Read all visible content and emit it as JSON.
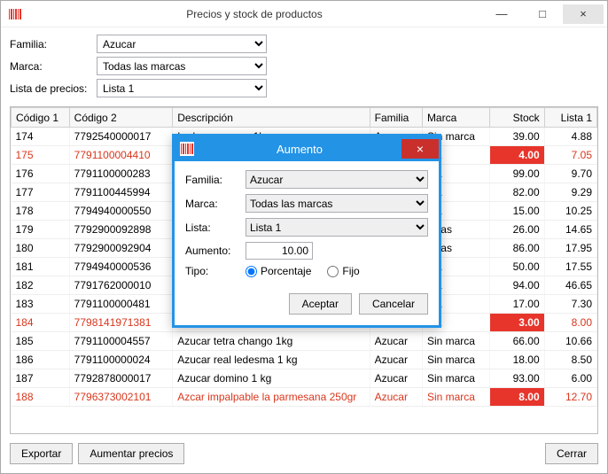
{
  "window": {
    "title": "Precios y stock de productos",
    "minimize": "—",
    "maximize": "□",
    "close": "×"
  },
  "filters": {
    "familia_label": "Familia:",
    "familia_value": "Azucar",
    "marca_label": "Marca:",
    "marca_value": "Todas las marcas",
    "lista_label": "Lista de precios:",
    "lista_value": "Lista 1"
  },
  "columns": {
    "codigo1": "Código 1",
    "codigo2": "Código 2",
    "descripcion": "Descripción",
    "familia": "Familia",
    "marca": "Marca",
    "stock": "Stock",
    "lista1": "Lista 1"
  },
  "rows": [
    {
      "c1": "174",
      "c2": "7792540000017",
      "desc": "Ledesma azcar 1kg",
      "fam": "Azucar",
      "marca": "Sin marca",
      "stock": "39.00",
      "price": "4.88",
      "red": false,
      "low": false
    },
    {
      "c1": "175",
      "c2": "7791100004410",
      "desc": "",
      "fam": "",
      "marca": "rca",
      "stock": "4.00",
      "price": "7.05",
      "red": true,
      "low": true
    },
    {
      "c1": "176",
      "c2": "7791100000283",
      "desc": "",
      "fam": "",
      "marca": "rca",
      "stock": "99.00",
      "price": "9.70",
      "red": false,
      "low": false
    },
    {
      "c1": "177",
      "c2": "7791100445994",
      "desc": "",
      "fam": "",
      "marca": "rca",
      "stock": "82.00",
      "price": "9.29",
      "red": false,
      "low": false
    },
    {
      "c1": "178",
      "c2": "7794940000550",
      "desc": "",
      "fam": "",
      "marca": "rca",
      "stock": "15.00",
      "price": "10.25",
      "red": false,
      "low": false
    },
    {
      "c1": "179",
      "c2": "7792900092898",
      "desc": "",
      "fam": "",
      "marca": "nclas",
      "stock": "26.00",
      "price": "14.65",
      "red": false,
      "low": false
    },
    {
      "c1": "180",
      "c2": "7792900092904",
      "desc": "",
      "fam": "",
      "marca": "nclas",
      "stock": "86.00",
      "price": "17.95",
      "red": false,
      "low": false
    },
    {
      "c1": "181",
      "c2": "7794940000536",
      "desc": "",
      "fam": "",
      "marca": "rca",
      "stock": "50.00",
      "price": "17.55",
      "red": false,
      "low": false
    },
    {
      "c1": "182",
      "c2": "7791762000010",
      "desc": "",
      "fam": "",
      "marca": "rca",
      "stock": "94.00",
      "price": "46.65",
      "red": false,
      "low": false
    },
    {
      "c1": "183",
      "c2": "7791100000481",
      "desc": "",
      "fam": "",
      "marca": "rca",
      "stock": "17.00",
      "price": "7.30",
      "red": false,
      "low": false
    },
    {
      "c1": "184",
      "c2": "7798141971381",
      "desc": "",
      "fam": "",
      "marca": "rca",
      "stock": "3.00",
      "price": "8.00",
      "red": true,
      "low": true
    },
    {
      "c1": "185",
      "c2": "7791100004557",
      "desc": "Azucar tetra chango 1kg",
      "fam": "Azucar",
      "marca": "Sin marca",
      "stock": "66.00",
      "price": "10.66",
      "red": false,
      "low": false
    },
    {
      "c1": "186",
      "c2": "7791100000024",
      "desc": "Azucar real ledesma 1 kg",
      "fam": "Azucar",
      "marca": "Sin marca",
      "stock": "18.00",
      "price": "8.50",
      "red": false,
      "low": false
    },
    {
      "c1": "187",
      "c2": "7792878000017",
      "desc": "Azucar domino 1 kg",
      "fam": "Azucar",
      "marca": "Sin marca",
      "stock": "93.00",
      "price": "6.00",
      "red": false,
      "low": false
    },
    {
      "c1": "188",
      "c2": "7796373002101",
      "desc": "Azcar impalpable la parmesana 250gr",
      "fam": "Azucar",
      "marca": "Sin marca",
      "stock": "8.00",
      "price": "12.70",
      "red": true,
      "low": true
    }
  ],
  "footer": {
    "exportar": "Exportar",
    "aumentar": "Aumentar precios",
    "cerrar": "Cerrar"
  },
  "modal": {
    "title": "Aumento",
    "close": "×",
    "familia_label": "Familia:",
    "familia_value": "Azucar",
    "marca_label": "Marca:",
    "marca_value": "Todas las marcas",
    "lista_label": "Lista:",
    "lista_value": "Lista 1",
    "aumento_label": "Aumento:",
    "aumento_value": "10.00",
    "tipo_label": "Tipo:",
    "tipo_porcentaje": "Porcentaje",
    "tipo_fijo": "Fijo",
    "aceptar": "Aceptar",
    "cancelar": "Cancelar"
  }
}
